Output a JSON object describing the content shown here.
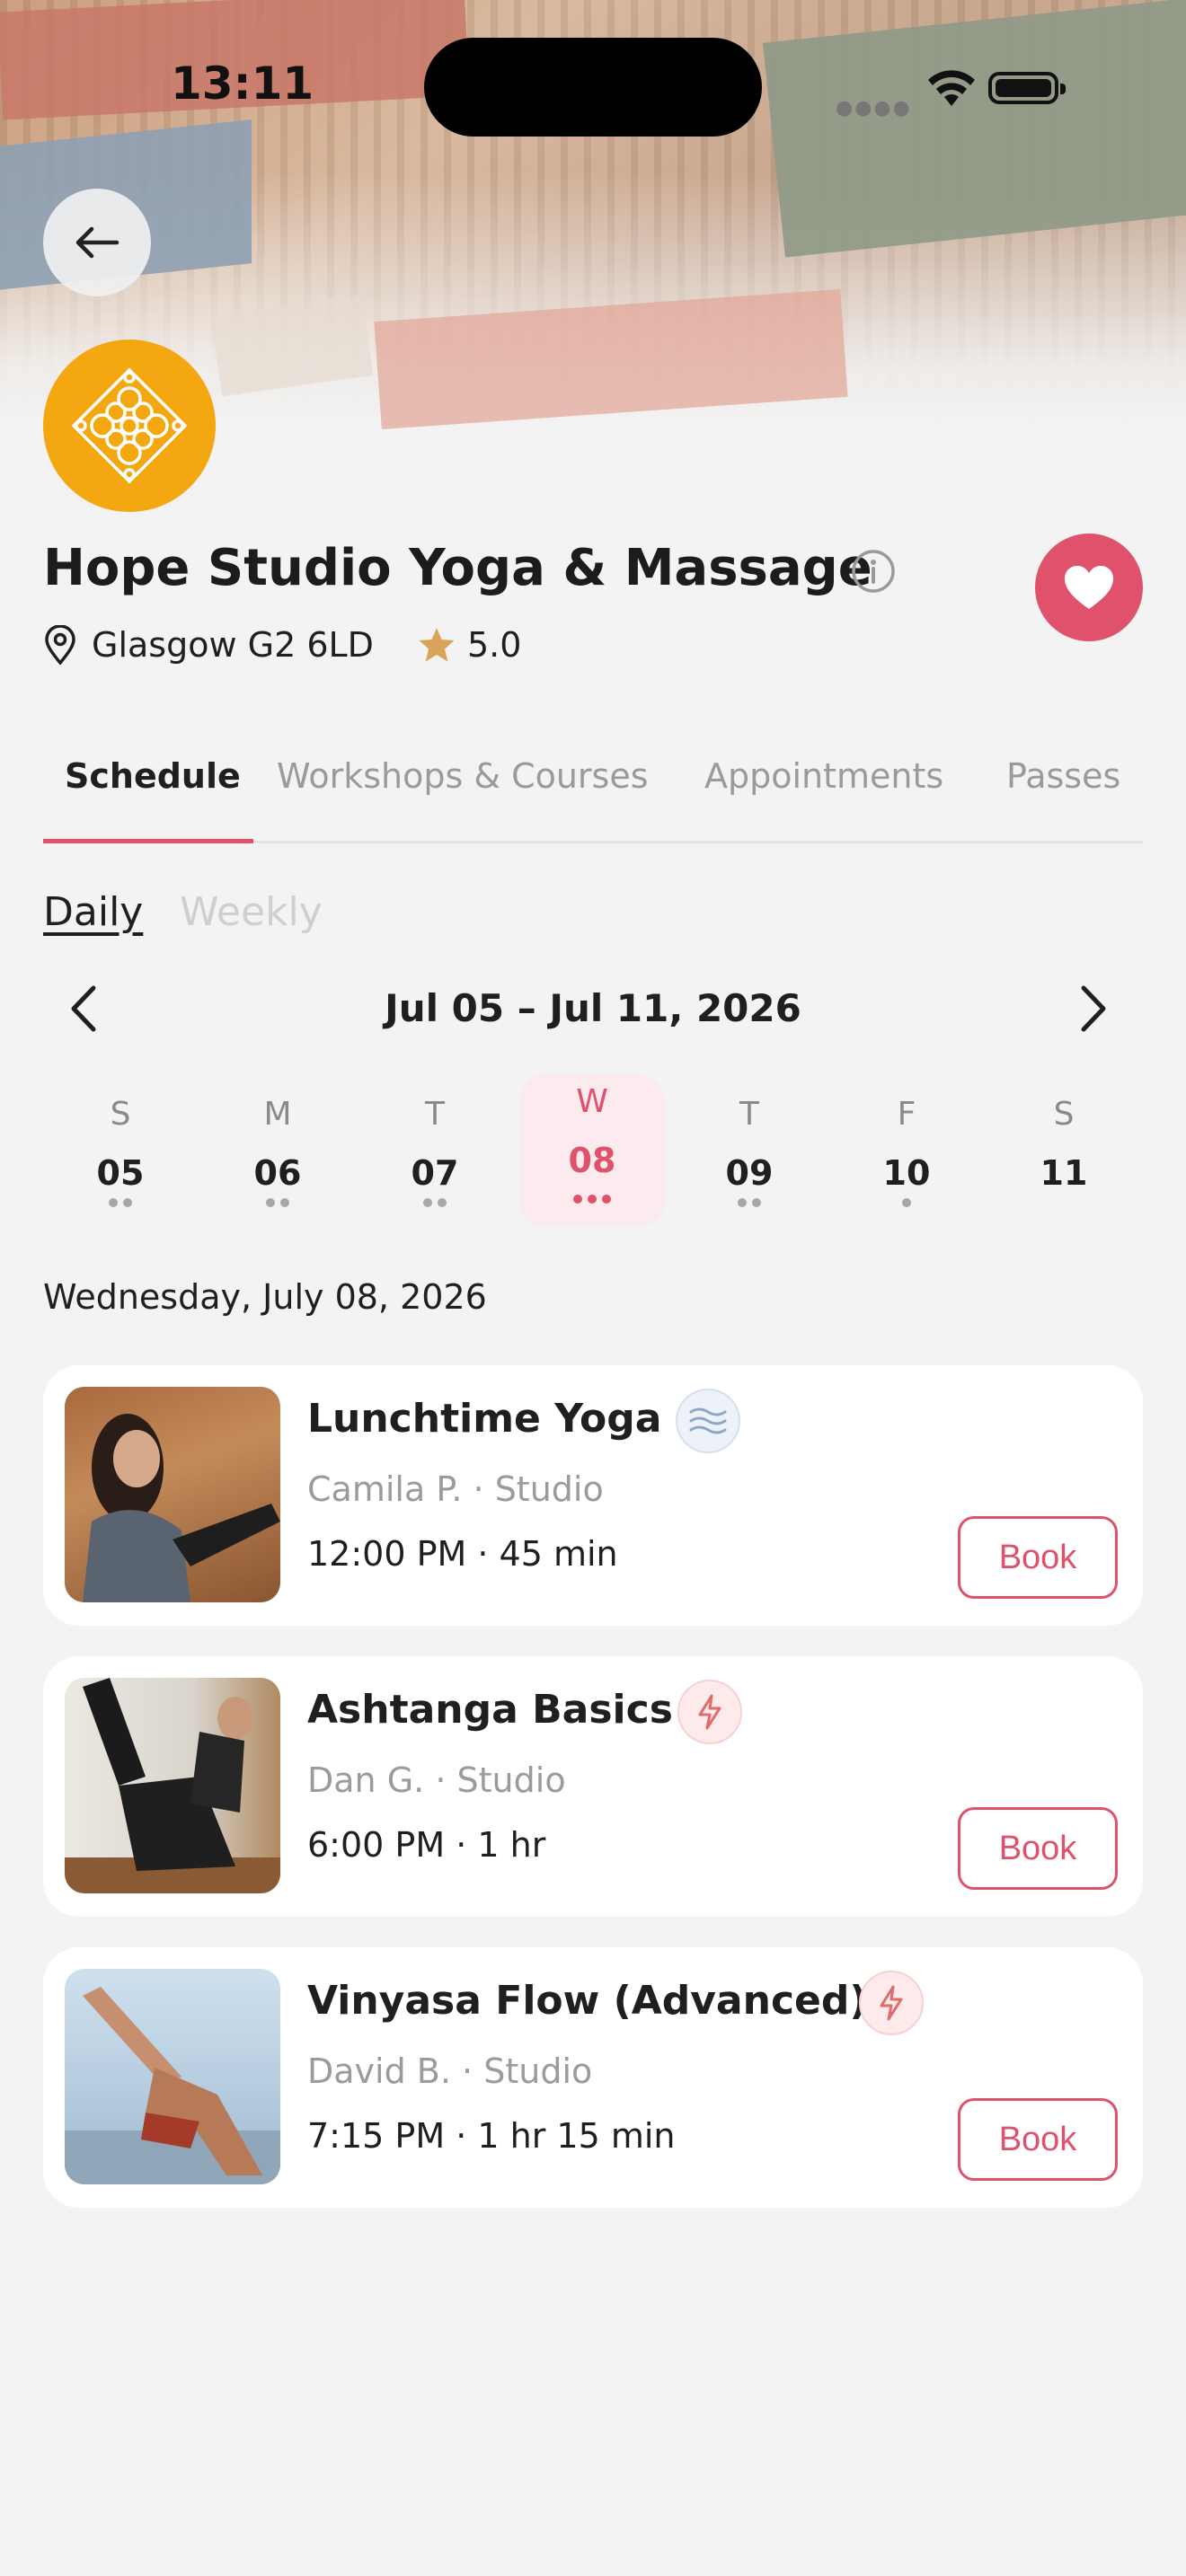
{
  "status_bar": {
    "time": "13:11"
  },
  "studio": {
    "name": "Hope Studio Yoga & Massage",
    "location": "Glasgow G2 6LD",
    "rating": "5.0"
  },
  "tabs": [
    "Schedule",
    "Workshops & Courses",
    "Appointments",
    "Passes"
  ],
  "view_modes": {
    "daily": "Daily",
    "weekly": "Weekly"
  },
  "range_label": "Jul 05 – Jul 11, 2026",
  "days": [
    {
      "dow": "S",
      "num": "05",
      "dots": 2
    },
    {
      "dow": "M",
      "num": "06",
      "dots": 2
    },
    {
      "dow": "T",
      "num": "07",
      "dots": 2
    },
    {
      "dow": "W",
      "num": "08",
      "dots": 3,
      "selected": true
    },
    {
      "dow": "T",
      "num": "09",
      "dots": 2
    },
    {
      "dow": "F",
      "num": "10",
      "dots": 1
    },
    {
      "dow": "S",
      "num": "11",
      "dots": 0
    }
  ],
  "selected_date_heading": "Wednesday, July 08, 2026",
  "classes": [
    {
      "name": "Lunchtime Yoga",
      "instructor": "Camila P.",
      "location": "Studio",
      "separator": "·",
      "time": "12:00 PM · 45 min",
      "badge": "waves-icon",
      "book_label": "Book"
    },
    {
      "name": "Ashtanga Basics",
      "instructor": "Dan G.",
      "location": "Studio",
      "separator": "·",
      "time": "6:00 PM · 1 hr",
      "badge": "lightning-icon",
      "book_label": "Book"
    },
    {
      "name": "Vinyasa Flow (Advanced)",
      "instructor": "David B.",
      "location": "Studio",
      "separator": "·",
      "time": "7:15 PM · 1 hr 15 min",
      "badge": "lightning-icon",
      "book_label": "Book"
    }
  ],
  "colors": {
    "accent": "#e0516b",
    "logo": "#f3a811",
    "star": "#d9a45a"
  }
}
